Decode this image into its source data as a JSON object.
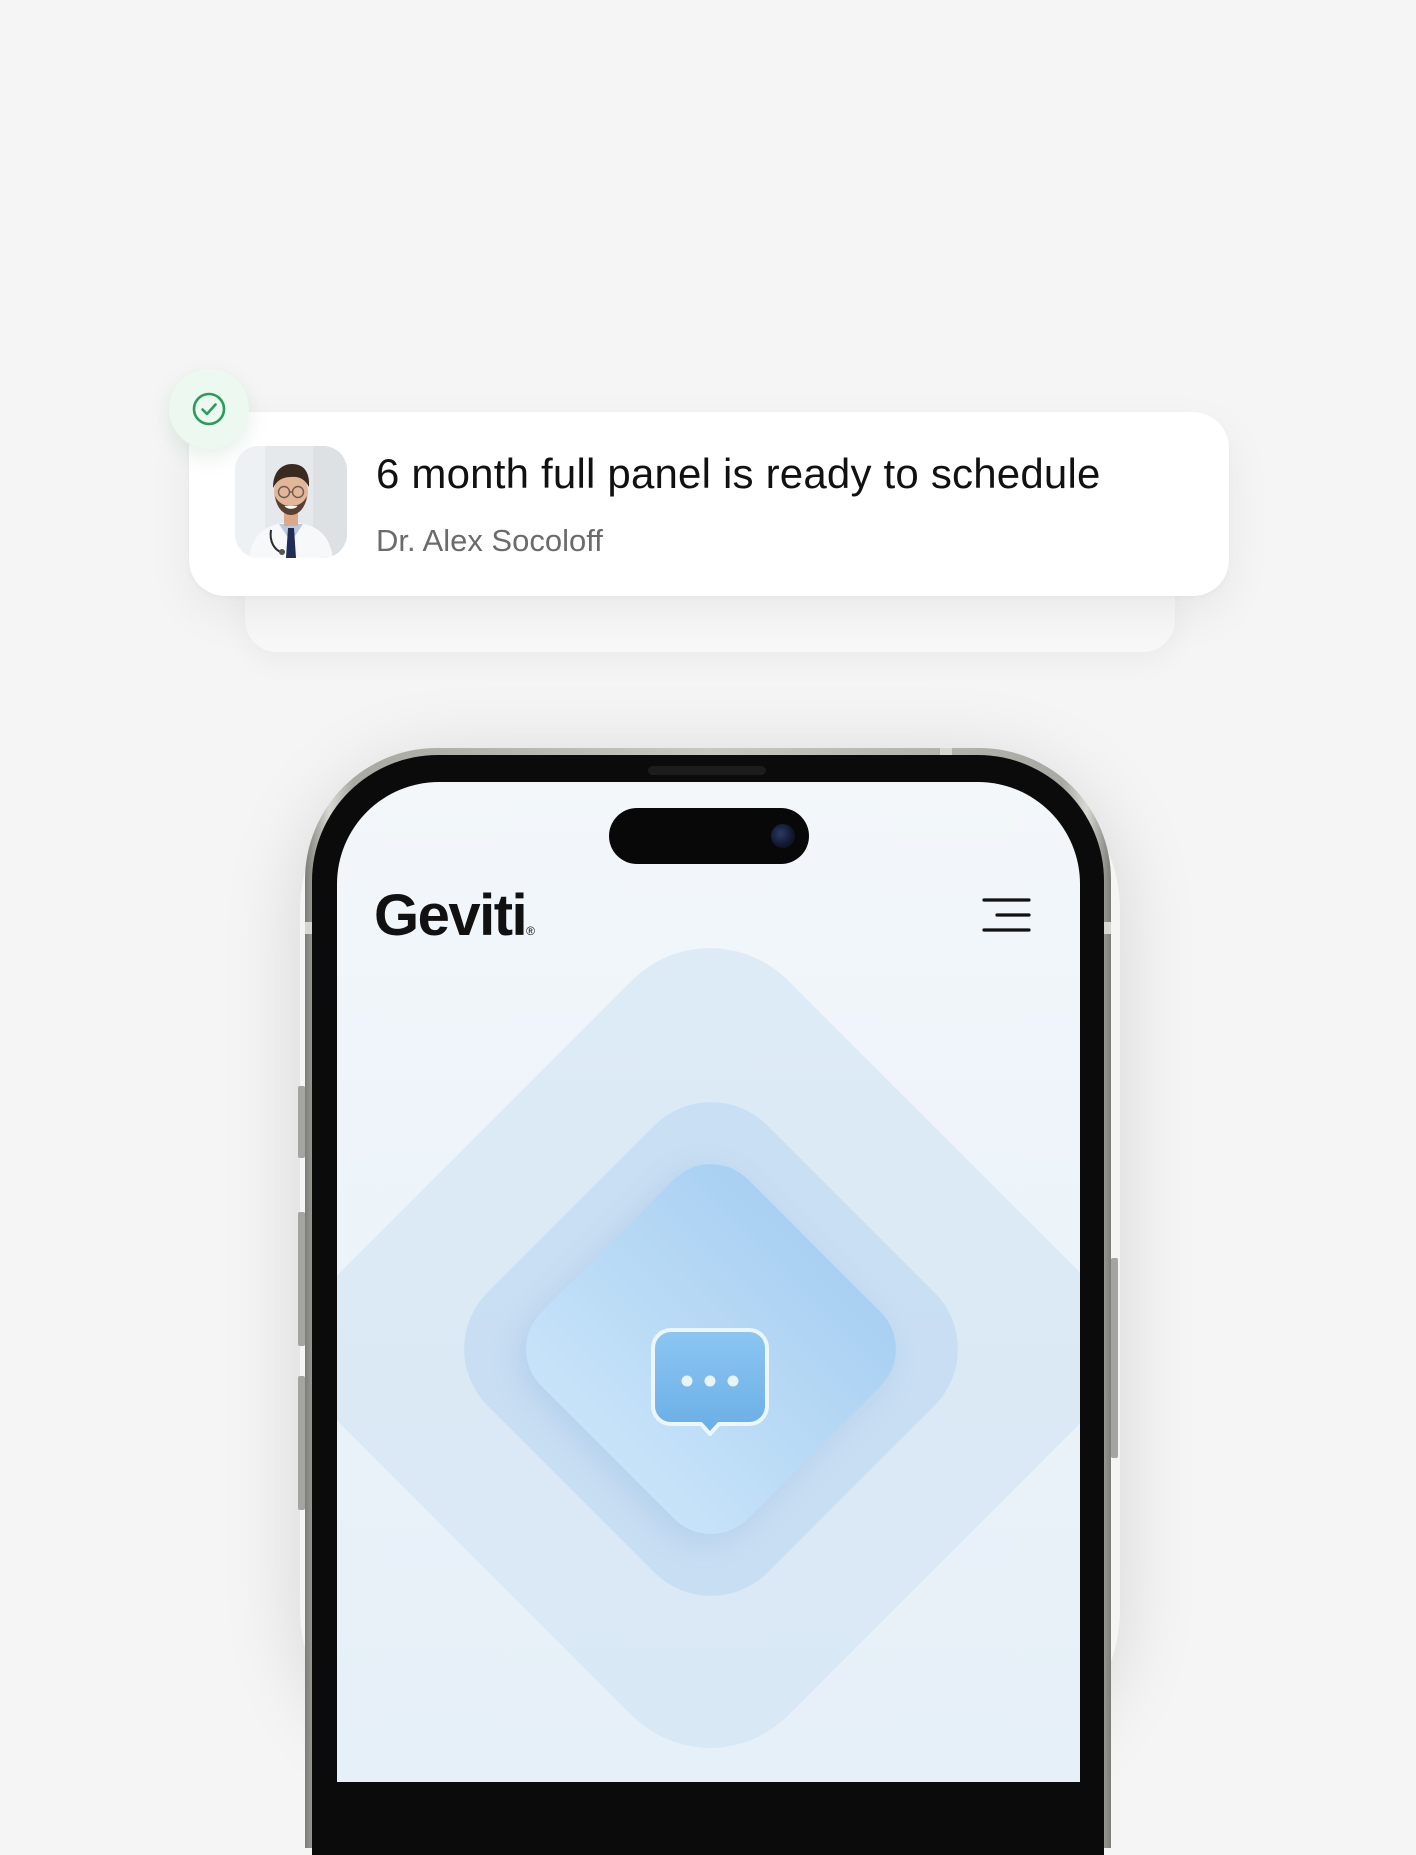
{
  "notification": {
    "title": "6 month full panel is ready to schedule",
    "sender": "Dr. Alex Socoloff",
    "status_icon": "check-circle-icon",
    "avatar": "doctor-avatar",
    "accent_color": "#2a9d5c"
  },
  "app": {
    "brand_name": "Geviti",
    "brand_mark": "®",
    "menu_icon": "hamburger-menu-icon",
    "center_icon": "chat-bubble-icon"
  },
  "colors": {
    "page_background": "#f5f5f5",
    "screen_background": "#eaf2f9",
    "chat_blue": "#7ab7ea"
  }
}
